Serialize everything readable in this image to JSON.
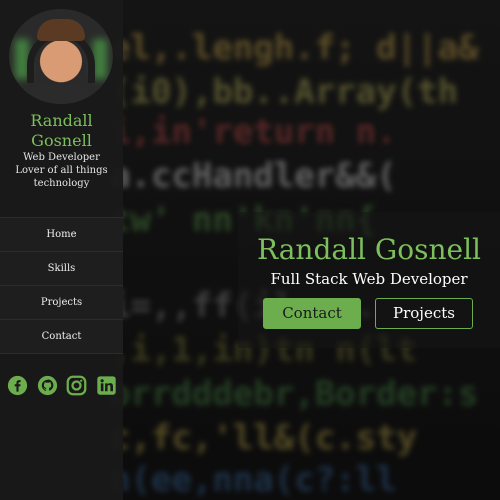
{
  "profile": {
    "name": "Randall Gosnell",
    "title": "Web Developer",
    "tagline": "Lover of all things technology"
  },
  "nav": {
    "items": [
      {
        "label": "Home"
      },
      {
        "label": "Skills"
      },
      {
        "label": "Projects"
      },
      {
        "label": "Contact"
      }
    ]
  },
  "socials": [
    {
      "icon": "facebook-icon"
    },
    {
      "icon": "github-icon"
    },
    {
      "icon": "instagram-icon"
    },
    {
      "icon": "linkedin-icon"
    }
  ],
  "hero": {
    "name": "Randall Gosnell",
    "subtitle": "Full Stack Web Developer",
    "contact_label": "Contact",
    "projects_label": "Projects"
  },
  "colors": {
    "accent": "#6cae4d",
    "sidebar_bg": "#1a1a1a",
    "text": "#ffffff"
  }
}
